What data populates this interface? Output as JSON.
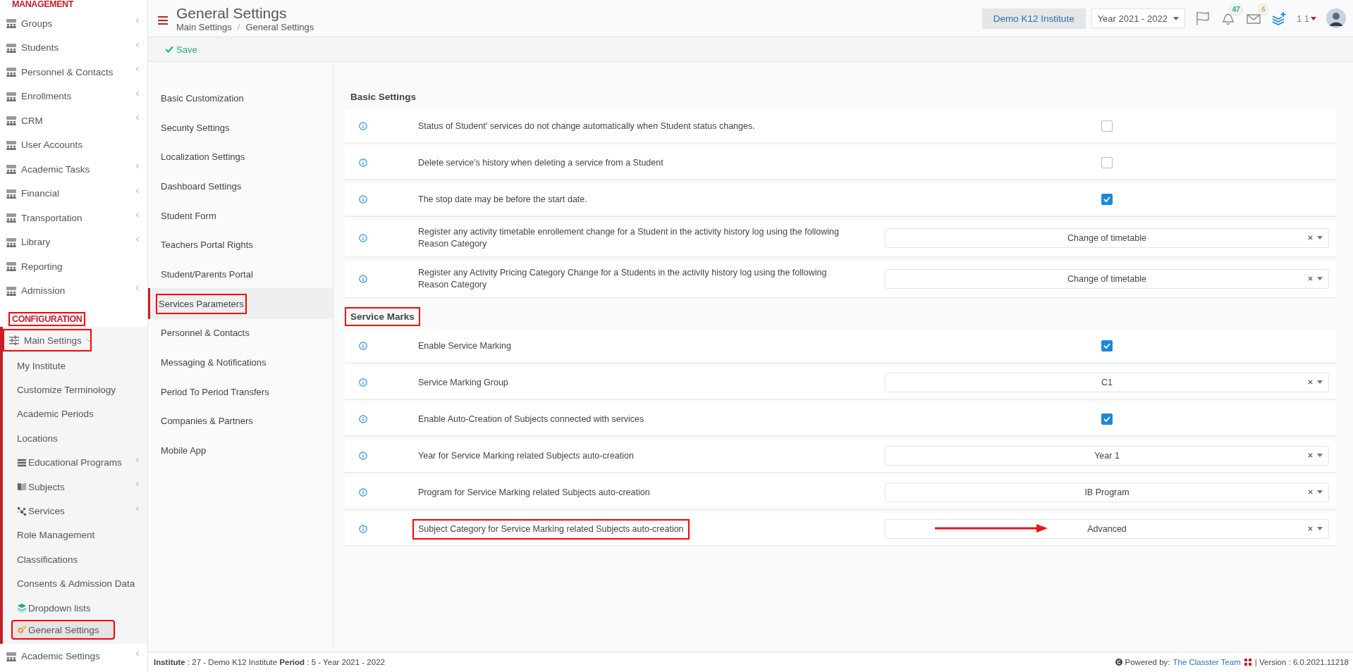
{
  "sidebar": {
    "sections": [
      {
        "title": "MANAGEMENT",
        "highlighted": false,
        "items": [
          {
            "label": "Groups",
            "has_submenu": true
          },
          {
            "label": "Students",
            "has_submenu": true
          },
          {
            "label": "Personnel & Contacts",
            "has_submenu": true
          },
          {
            "label": "Enrollments",
            "has_submenu": true
          },
          {
            "label": "CRM",
            "has_submenu": true
          },
          {
            "label": "User Accounts",
            "has_submenu": false
          },
          {
            "label": "Academic Tasks",
            "has_submenu": true
          },
          {
            "label": "Financial",
            "has_submenu": true
          },
          {
            "label": "Transportation",
            "has_submenu": true
          },
          {
            "label": "Library",
            "has_submenu": true
          },
          {
            "label": "Reporting",
            "has_submenu": false
          },
          {
            "label": "Admission",
            "has_submenu": true
          }
        ]
      },
      {
        "title": "CONFIGURATION",
        "highlighted": true,
        "items": [
          {
            "label": "Main Settings",
            "has_submenu": true,
            "expanded": true,
            "highlighted": true,
            "children": [
              {
                "label": "My Institute",
                "has_submenu": false,
                "selected": false,
                "highlighted": false
              },
              {
                "label": "Customize Terminology",
                "has_submenu": false,
                "selected": false,
                "highlighted": false
              },
              {
                "label": "Academic Periods",
                "has_submenu": false,
                "selected": false,
                "highlighted": false
              },
              {
                "label": "Locations",
                "has_submenu": false,
                "selected": false,
                "highlighted": false
              },
              {
                "label": "Educational Programs",
                "has_submenu": true,
                "selected": false,
                "highlighted": false
              },
              {
                "label": "Subjects",
                "has_submenu": true,
                "selected": false,
                "highlighted": false
              },
              {
                "label": "Services",
                "has_submenu": true,
                "selected": false,
                "highlighted": false
              },
              {
                "label": "Role Management",
                "has_submenu": false,
                "selected": false,
                "highlighted": false
              },
              {
                "label": "Classifications",
                "has_submenu": false,
                "selected": false,
                "highlighted": false
              },
              {
                "label": "Consents & Admission Data",
                "has_submenu": false,
                "selected": false,
                "highlighted": false
              },
              {
                "label": "Dropdown lists",
                "has_submenu": false,
                "selected": false,
                "highlighted": false
              },
              {
                "label": "General Settings",
                "has_submenu": false,
                "selected": true,
                "highlighted": true
              }
            ]
          },
          {
            "label": "Academic Settings",
            "has_submenu": true
          }
        ]
      }
    ]
  },
  "header": {
    "title": "General Settings",
    "breadcrumb": [
      "Main Settings",
      "General Settings"
    ],
    "breadcrumb_separator": "/",
    "institute": "Demo K12 Institute",
    "year": "Year 2021 - 2022",
    "notifications": "47",
    "messages": "6",
    "user": "1 1"
  },
  "toolbar": {
    "save": "Save"
  },
  "settings_nav": [
    {
      "label": "Basic Customization",
      "selected": false,
      "highlighted": false
    },
    {
      "label": "Security Settings",
      "selected": false,
      "highlighted": false
    },
    {
      "label": "Localization Settings",
      "selected": false,
      "highlighted": false
    },
    {
      "label": "Dashboard Settings",
      "selected": false,
      "highlighted": false
    },
    {
      "label": "Student Form",
      "selected": false,
      "highlighted": false
    },
    {
      "label": "Teachers Portal Rights",
      "selected": false,
      "highlighted": false
    },
    {
      "label": "Student/Parents Portal",
      "selected": false,
      "highlighted": false
    },
    {
      "label": "Services Parameters",
      "selected": true,
      "highlighted": true
    },
    {
      "label": "Personnel & Contacts",
      "selected": false,
      "highlighted": false
    },
    {
      "label": "Messaging & Notifications",
      "selected": false,
      "highlighted": false
    },
    {
      "label": "Period To Period Transfers",
      "selected": false,
      "highlighted": false
    },
    {
      "label": "Companies & Partners",
      "selected": false,
      "highlighted": false
    },
    {
      "label": "Mobile App",
      "selected": false,
      "highlighted": false
    }
  ],
  "groups": [
    {
      "title": "Basic Settings",
      "highlighted": false,
      "rows": [
        {
          "kind": "checkbox",
          "label": "Status of Student' services do not change automatically when Student status changes.",
          "checked": false
        },
        {
          "kind": "checkbox",
          "label": "Delete service's history when deleting a service from a Student",
          "checked": false
        },
        {
          "kind": "checkbox",
          "label": "The stop date may be before the start date.",
          "checked": true
        },
        {
          "kind": "select",
          "label": "Register any activity timetable enrollement change for a Student in the activity history log using the following Reason Category",
          "value": "Change of timetable"
        },
        {
          "kind": "select",
          "label": "Register any Activity Pricing Category Change for a Students in the activity history log using the following Reason Category",
          "value": "Change of timetable"
        }
      ]
    },
    {
      "title": "Service Marks",
      "highlighted": true,
      "rows": [
        {
          "kind": "checkbox",
          "label": "Enable Service Marking",
          "checked": true
        },
        {
          "kind": "select",
          "label": "Service Marking Group",
          "value": "C1"
        },
        {
          "kind": "checkbox",
          "label": "Enable Auto-Creation of Subjects connected with services",
          "checked": true
        },
        {
          "kind": "select",
          "label": "Year for Service Marking related Subjects auto-creation",
          "value": "Year 1"
        },
        {
          "kind": "select",
          "label": "Program for Service Marking related Subjects auto-creation",
          "value": "IB Program"
        },
        {
          "kind": "select",
          "label": "Subject Category for Service Marking related Subjects auto-creation",
          "value": "Advanced",
          "highlighted": true,
          "arrow": true
        }
      ]
    }
  ],
  "footer": {
    "info": "**Institute** : 27 - Demo K12 Institute **Period** : 5 - Year 2021 - 2022",
    "powered": "Powered by:",
    "link": "The Classter Team",
    "version": "| Version : 6.0.2021.11218"
  }
}
